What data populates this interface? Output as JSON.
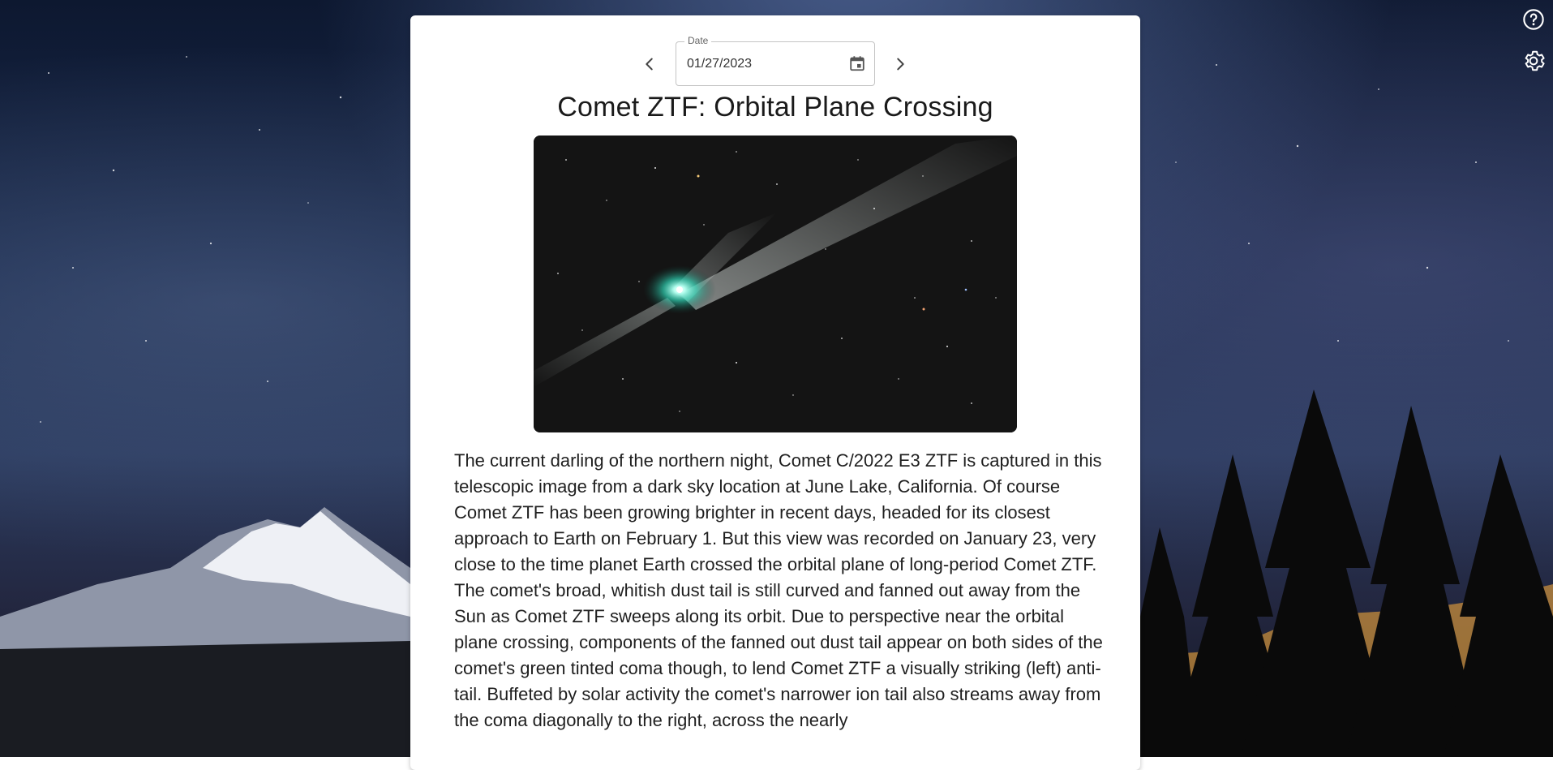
{
  "date_picker": {
    "label": "Date",
    "value": "01/27/2023"
  },
  "apod": {
    "title": "Comet ZTF: Orbital Plane Crossing",
    "explanation": "The current darling of the northern night, Comet C/2022 E3 ZTF is captured in this telescopic image from a dark sky location at June Lake, California. Of course Comet ZTF has been growing brighter in recent days, headed for its closest approach to Earth on February 1. But this view was recorded on January 23, very close to the time planet Earth crossed the orbital plane of long-period Comet ZTF. The comet's broad, whitish dust tail is still curved and fanned out away from the Sun as Comet ZTF sweeps along its orbit. Due to perspective near the orbital plane crossing, components of the fanned out dust tail appear on both sides of the comet's green tinted coma though, to lend Comet ZTF a visually striking (left) anti-tail. Buffeted by solar activity the comet's narrower ion tail also streams away from the coma diagonally to the right, across the nearly"
  },
  "icons": {
    "prev": "chevron-left-icon",
    "next": "chevron-right-icon",
    "calendar": "calendar-icon",
    "help": "help-circle-icon",
    "settings": "gear-icon"
  },
  "colors": {
    "card_background": "#ffffff",
    "icon_white": "#ffffff",
    "coma_green": "#2fd3b4"
  }
}
